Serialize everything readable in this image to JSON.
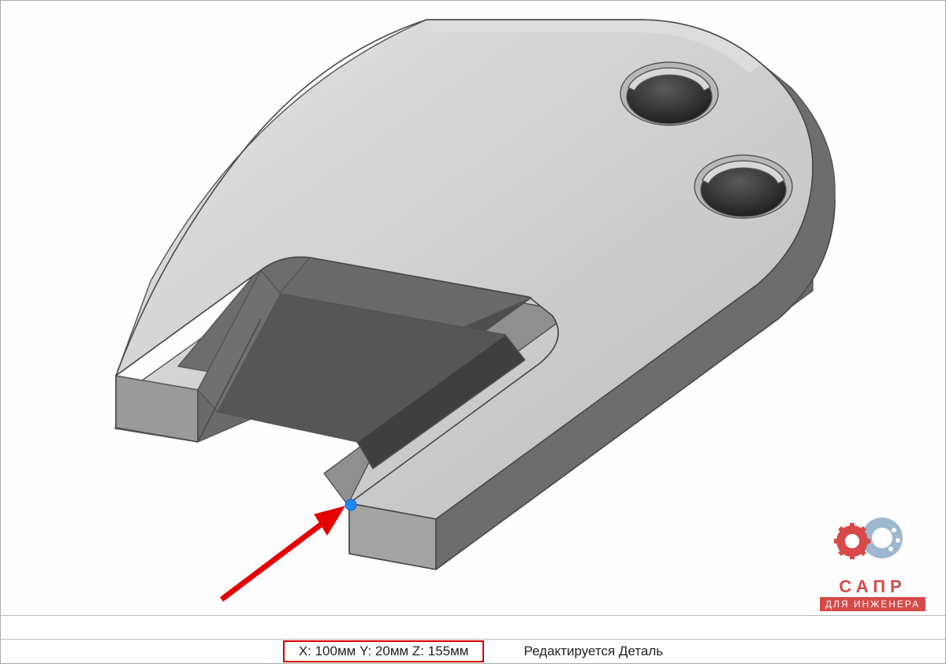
{
  "status": {
    "coords_text": "X: 100мм Y: 20мм Z: 155мм",
    "x_label": "X:",
    "x_value": "100мм",
    "y_label": "Y:",
    "y_value": "20мм",
    "z_label": "Z:",
    "z_value": "155мм",
    "mode_text": "Редактируется Деталь"
  },
  "annotation": {
    "arrow_color": "#ff0000",
    "arrow_target": "selected-vertex"
  },
  "selection": {
    "vertex_color": "#1e88ff"
  },
  "logo": {
    "line1": "САПР",
    "line2": "ДЛЯ ИНЖЕНЕРА"
  },
  "part_colors": {
    "face_light": "#cfcfcf",
    "face_mid": "#ababab",
    "face_dark": "#7e7e7e",
    "edge": "#5a5a5a"
  }
}
